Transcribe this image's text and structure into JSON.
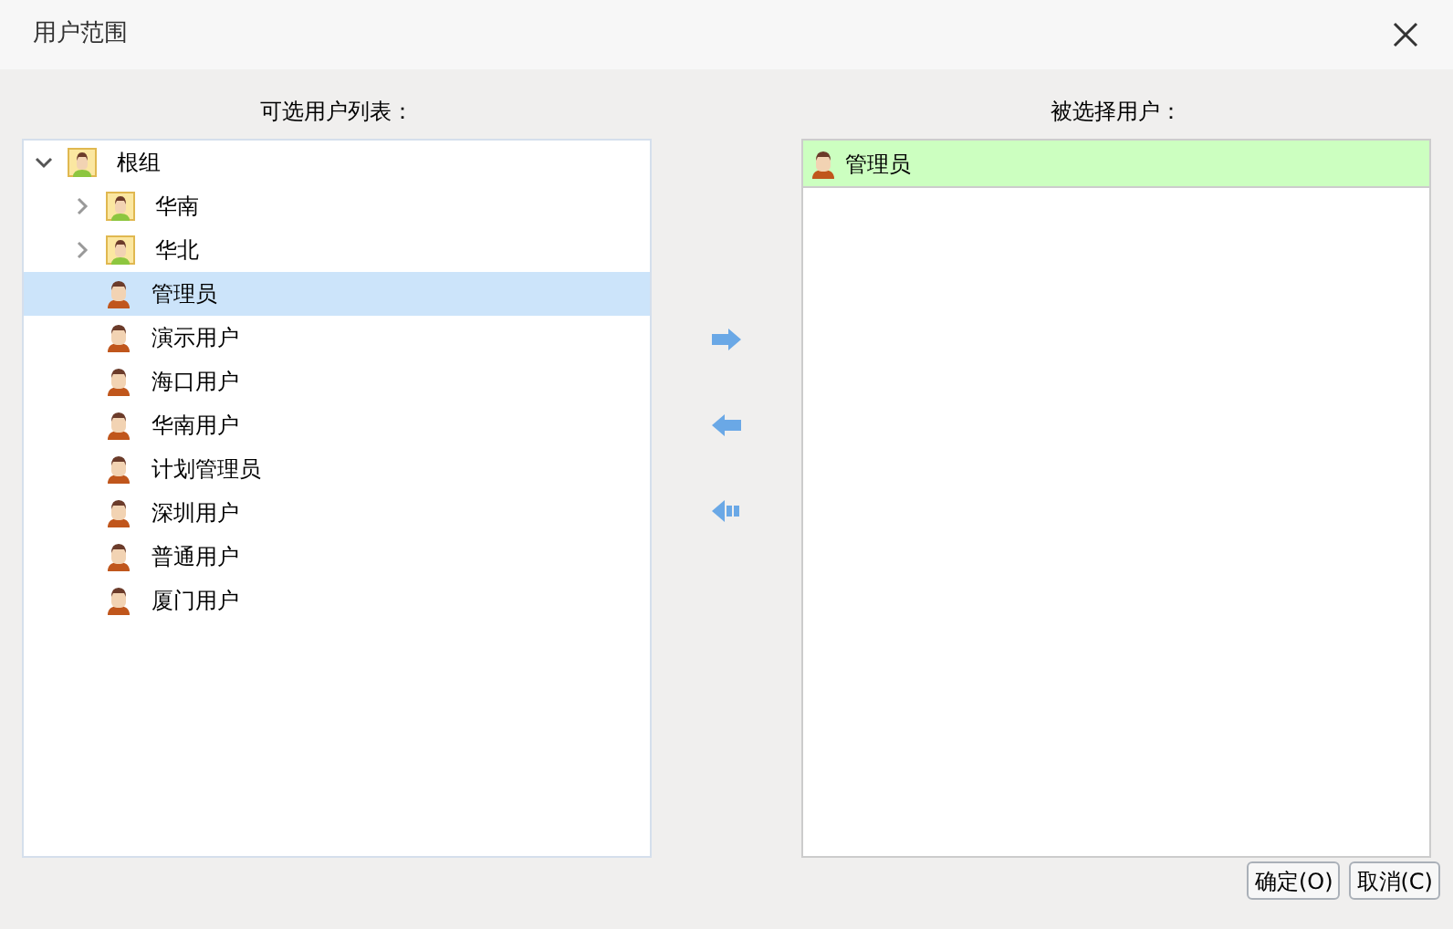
{
  "window": {
    "title": "用户范围"
  },
  "available": {
    "label": "可选用户列表：",
    "tree": [
      {
        "label": "根组",
        "kind": "group",
        "expanded": true,
        "selected": false,
        "children": [
          {
            "label": "华南",
            "kind": "group",
            "expanded": false,
            "selected": false
          },
          {
            "label": "华北",
            "kind": "group",
            "expanded": false,
            "selected": false
          },
          {
            "label": "管理员",
            "kind": "user",
            "selected": true
          },
          {
            "label": "演示用户",
            "kind": "user",
            "selected": false
          },
          {
            "label": "海口用户",
            "kind": "user",
            "selected": false
          },
          {
            "label": "华南用户",
            "kind": "user",
            "selected": false
          },
          {
            "label": "计划管理员",
            "kind": "user",
            "selected": false
          },
          {
            "label": "深圳用户",
            "kind": "user",
            "selected": false
          },
          {
            "label": "普通用户",
            "kind": "user",
            "selected": false
          },
          {
            "label": "厦门用户",
            "kind": "user",
            "selected": false
          }
        ]
      }
    ]
  },
  "chosen": {
    "label": "被选择用户：",
    "items": [
      {
        "label": "管理员",
        "selected": true
      }
    ]
  },
  "buttons": [
    "确定(O)",
    "取消(C)"
  ]
}
